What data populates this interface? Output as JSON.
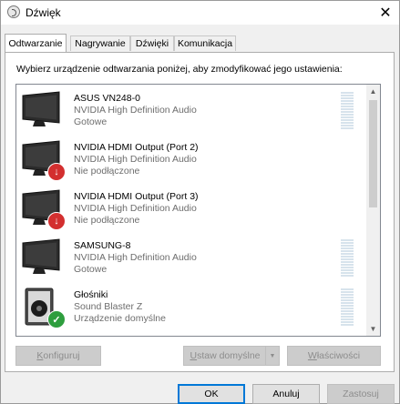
{
  "window": {
    "title": "Dźwięk",
    "close_glyph": "✕"
  },
  "tabs": [
    {
      "label": "Odtwarzanie",
      "active": true
    },
    {
      "label": "Nagrywanie",
      "active": false
    },
    {
      "label": "Dźwięki",
      "active": false
    },
    {
      "label": "Komunikacja",
      "active": false
    }
  ],
  "playback": {
    "instruction": "Wybierz urządzenie odtwarzania poniżej, aby zmodyfikować jego ustawienia:",
    "devices": [
      {
        "name": "ASUS VN248-0",
        "driver": "NVIDIA High Definition Audio",
        "status": "Gotowe",
        "icon": "monitor-icon",
        "badge": "none",
        "show_meter": true
      },
      {
        "name": "NVIDIA HDMI Output (Port 2)",
        "driver": "NVIDIA High Definition Audio",
        "status": "Nie podłączone",
        "icon": "monitor-icon",
        "badge": "disconnected-arrow-icon",
        "show_meter": false
      },
      {
        "name": "NVIDIA HDMI Output (Port 3)",
        "driver": "NVIDIA High Definition Audio",
        "status": "Nie podłączone",
        "icon": "monitor-icon",
        "badge": "disconnected-arrow-icon",
        "show_meter": false
      },
      {
        "name": "SAMSUNG-8",
        "driver": "NVIDIA High Definition Audio",
        "status": "Gotowe",
        "icon": "monitor-icon",
        "badge": "none",
        "show_meter": true
      },
      {
        "name": "Głośniki",
        "driver": "Sound Blaster Z",
        "status": "Urządzenie domyślne",
        "icon": "speaker-icon",
        "badge": "default-check-icon",
        "show_meter": true
      }
    ],
    "buttons": {
      "configure": {
        "underline": "K",
        "rest": "onfiguruj"
      },
      "set_default": {
        "underline": "U",
        "rest": "staw domyślne"
      },
      "properties": {
        "underline": "W",
        "rest": "łaściwości"
      }
    }
  },
  "footer": {
    "ok": "OK",
    "cancel": "Anuluj",
    "apply": "Zastosuj"
  },
  "colors": {
    "badge_red": "#d32f2f",
    "badge_green": "#2e9e3e",
    "default_button_border": "#0078d7"
  }
}
